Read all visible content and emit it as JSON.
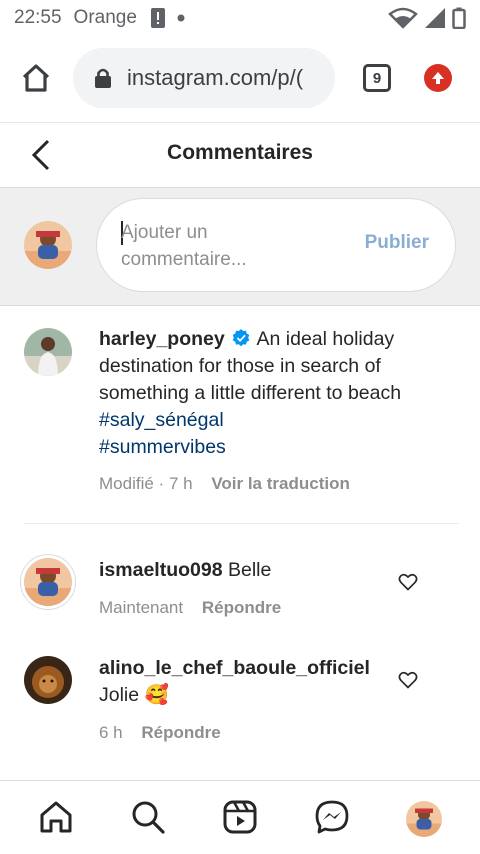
{
  "status_bar": {
    "time": "22:55",
    "carrier": "Orange"
  },
  "browser": {
    "url": "instagram.com/p/(",
    "tab_count": "9"
  },
  "header": {
    "title": "Commentaires"
  },
  "composer": {
    "placeholder": "Ajouter un commentaire...",
    "publish_label": "Publier"
  },
  "caption": {
    "username": "harley_poney",
    "text": "An ideal holiday destination for those in search of something a little different to beach",
    "hashtags": [
      "#saly_sénégal",
      "#summervibes"
    ],
    "edited": "Modifié",
    "time": "7 h",
    "translate_label": "Voir la traduction"
  },
  "comments": [
    {
      "username": "ismaeltuo098",
      "text": "Belle",
      "time": "Maintenant",
      "reply_label": "Répondre"
    },
    {
      "username": "alino_le_chef_baoule_officiel",
      "text": "Jolie 🥰",
      "time": "6 h",
      "reply_label": "Répondre"
    }
  ],
  "colors": {
    "link": "#00376b",
    "publish_disabled": "#8aaed3",
    "verified": "#0095f6",
    "update_badge": "#d93025"
  },
  "icons": {
    "nav": [
      "home-icon",
      "search-icon",
      "reels-icon",
      "messenger-icon",
      "profile-avatar"
    ]
  }
}
